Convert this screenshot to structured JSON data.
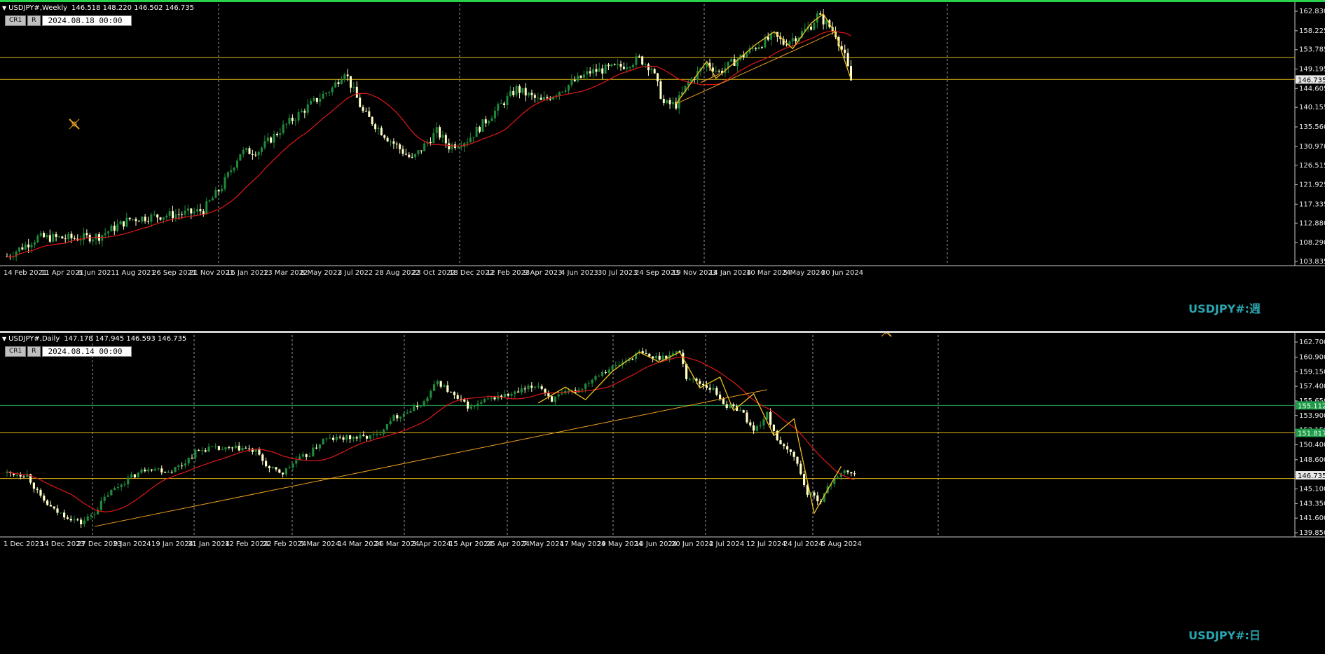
{
  "colors": {
    "background": "#000000",
    "bull_candle": "#1f8a3c",
    "bear_candle": "#ffffc8",
    "ma_line": "#e01818",
    "h_level": "#e0b818",
    "h_level_green": "#1f9a4a",
    "trendline": "#f0a020",
    "watermark": "#2aa6b0",
    "grid": "#9a9a9a"
  },
  "weekly": {
    "symbol": "USDJPY#,Weekly",
    "ohlc": "146.518 148.220 146.502 146.735",
    "cr1_label": "CR1",
    "r_label": "R",
    "date_value": "2024.08.18 00:00",
    "watermark": "USDJPY#:週",
    "current_price": "146.735",
    "icon": "crosshair-pencil-icon",
    "y_ticks": [
      "162.830",
      "158.225",
      "153.785",
      "149.195",
      "144.605",
      "140.155",
      "135.560",
      "130.970",
      "126.515",
      "121.925",
      "117.335",
      "112.880",
      "108.290",
      "103.835"
    ],
    "y_min": 103.835,
    "y_max": 162.83,
    "x_labels": [
      "14 Feb 2021",
      "11 Apr 2021",
      "6 Jun 2021",
      "1 Aug 2021",
      "26 Sep 2021",
      "21 Nov 2021",
      "16 Jan 2022",
      "13 Mar 2022",
      "8 May 2022",
      "3 Jul 2022",
      "28 Aug 2022",
      "23 Oct 2022",
      "18 Dec 2022",
      "12 Feb 2023",
      "9 Apr 2023",
      "4 Jun 2023",
      "30 Jul 2023",
      "24 Sep 2023",
      "19 Nov 2023",
      "14 Jan 2024",
      "10 Mar 2024",
      "5 May 2024",
      "30 Jun 2024"
    ],
    "h_levels": [
      151.9,
      146.75
    ],
    "keypoints": [
      [
        0,
        105.0
      ],
      [
        10,
        109.5
      ],
      [
        22,
        109.3
      ],
      [
        30,
        109.8
      ],
      [
        40,
        113.8
      ],
      [
        50,
        114.6
      ],
      [
        60,
        115.3
      ],
      [
        64,
        116.0
      ],
      [
        70,
        121.5
      ],
      [
        76,
        129.5
      ],
      [
        82,
        130.0
      ],
      [
        90,
        135.5
      ],
      [
        100,
        141.5
      ],
      [
        106,
        144.7
      ],
      [
        110,
        148.8
      ],
      [
        116,
        139.0
      ],
      [
        124,
        133.0
      ],
      [
        132,
        127.8
      ],
      [
        140,
        134.5
      ],
      [
        144,
        131.0
      ],
      [
        150,
        132.5
      ],
      [
        160,
        140.0
      ],
      [
        166,
        144.5
      ],
      [
        174,
        141.5
      ],
      [
        182,
        145.0
      ],
      [
        190,
        148.5
      ],
      [
        200,
        149.8
      ],
      [
        206,
        151.6
      ],
      [
        210,
        149.5
      ],
      [
        214,
        141.0
      ],
      [
        218,
        140.8
      ],
      [
        222,
        146.0
      ],
      [
        228,
        150.5
      ],
      [
        232,
        148.5
      ],
      [
        238,
        151.5
      ],
      [
        244,
        154.5
      ],
      [
        250,
        157.0
      ],
      [
        253,
        155.3
      ],
      [
        258,
        157.2
      ],
      [
        262,
        159.5
      ],
      [
        264,
        161.8
      ],
      [
        267,
        160.0
      ],
      [
        270,
        157.5
      ],
      [
        273,
        152.0
      ],
      [
        275,
        146.5
      ]
    ],
    "ma_period": 20
  },
  "daily": {
    "symbol": "USDJPY#,Daily",
    "ohlc": "147.178 147.945 146.593 146.735",
    "cr1_label": "CR1",
    "r_label": "R",
    "date_value": "2024.08.14 00:00",
    "watermark": "USDJPY#:日",
    "current_price": "146.735",
    "level_mid": "155.112",
    "level_low": "151.817",
    "icon": "crosshair-pencil-icon",
    "y_ticks": [
      "162.700",
      "160.900",
      "159.150",
      "157.400",
      "155.650",
      "153.900",
      "152.150",
      "150.400",
      "148.600",
      "146.850",
      "145.100",
      "143.350",
      "141.600",
      "139.850"
    ],
    "y_min": 139.85,
    "y_max": 162.7,
    "x_labels": [
      "1 Dec 2023",
      "14 Dec 2023",
      "27 Dec 2023",
      "9 Jan 2024",
      "19 Jan 2024",
      "31 Jan 2024",
      "12 Feb 2024",
      "22 Feb 2024",
      "5 Mar 2024",
      "14 Mar 2024",
      "26 Mar 2024",
      "3 Apr 2024",
      "15 Apr 2024",
      "25 Apr 2024",
      "7 May 2024",
      "17 May 2024",
      "29 May 2024",
      "10 Jun 2024",
      "20 Jun 2024",
      "2 Jul 2024",
      "12 Jul 2024",
      "24 Jul 2024",
      "5 Aug 2024"
    ],
    "h_levels": [
      155.112,
      151.817,
      146.35
    ],
    "keypoints": [
      [
        0,
        147.0
      ],
      [
        6,
        146.8
      ],
      [
        10,
        144.0
      ],
      [
        14,
        142.5
      ],
      [
        18,
        141.8
      ],
      [
        22,
        141.0
      ],
      [
        26,
        142.3
      ],
      [
        30,
        144.5
      ],
      [
        36,
        146.3
      ],
      [
        42,
        147.7
      ],
      [
        48,
        147.2
      ],
      [
        52,
        148.0
      ],
      [
        56,
        149.5
      ],
      [
        60,
        150.0
      ],
      [
        64,
        149.8
      ],
      [
        70,
        150.0
      ],
      [
        74,
        149.5
      ],
      [
        78,
        147.5
      ],
      [
        82,
        147.0
      ],
      [
        86,
        148.5
      ],
      [
        90,
        149.3
      ],
      [
        94,
        151.0
      ],
      [
        100,
        151.2
      ],
      [
        106,
        151.3
      ],
      [
        110,
        151.5
      ],
      [
        114,
        153.5
      ],
      [
        120,
        154.5
      ],
      [
        124,
        155.5
      ],
      [
        128,
        158.0
      ],
      [
        130,
        157.3
      ],
      [
        134,
        155.8
      ],
      [
        138,
        154.8
      ],
      [
        142,
        155.6
      ],
      [
        146,
        156.2
      ],
      [
        150,
        156.4
      ],
      [
        154,
        157.0
      ],
      [
        158,
        157.6
      ],
      [
        162,
        155.8
      ],
      [
        166,
        156.5
      ],
      [
        170,
        157.0
      ],
      [
        176,
        159.0
      ],
      [
        182,
        160.0
      ],
      [
        188,
        161.4
      ],
      [
        192,
        160.8
      ],
      [
        196,
        161.0
      ],
      [
        200,
        161.6
      ],
      [
        202,
        158.5
      ],
      [
        206,
        157.8
      ],
      [
        210,
        157.0
      ],
      [
        214,
        155.0
      ],
      [
        218,
        154.7
      ],
      [
        222,
        152.0
      ],
      [
        226,
        154.0
      ],
      [
        230,
        150.2
      ],
      [
        234,
        149.2
      ],
      [
        238,
        144.5
      ],
      [
        242,
        143.8
      ],
      [
        246,
        146.5
      ],
      [
        250,
        147.2
      ],
      [
        252,
        146.7
      ]
    ],
    "ma_period": 20
  }
}
